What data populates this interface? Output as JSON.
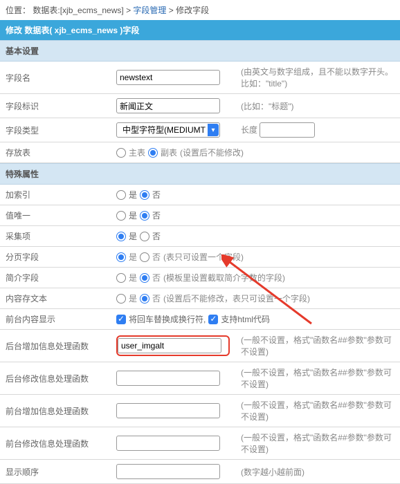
{
  "breadcrumb": {
    "loc": "位置：",
    "table": "数据表:[xjb_ecms_news]",
    "sep": " > ",
    "link1": "字段管理",
    "current": "修改字段"
  },
  "title": "修改 数据表( xjb_ecms_news )字段",
  "sections": {
    "basic": "基本设置",
    "special": "特殊属性"
  },
  "rows": {
    "fname": {
      "label": "字段名",
      "value": "newstext",
      "hint": "(由英文与数字组成，且不能以数字开头。比如：\"title\")"
    },
    "fflag": {
      "label": "字段标识",
      "value": "新闻正文",
      "hint": "(比如：\"标题\")"
    },
    "ftype": {
      "label": "字段类型",
      "value": "中型字符型(MEDIUMTEXT)",
      "len_label": "长度",
      "len_value": ""
    },
    "store": {
      "label": "存放表",
      "main": "主表",
      "sub": "副表",
      "hint": "(设置后不能修改)"
    },
    "index": {
      "label": "加索引",
      "yes": "是",
      "no": "否"
    },
    "unique": {
      "label": "值唯一",
      "yes": "是",
      "no": "否"
    },
    "collect": {
      "label": "采集项",
      "yes": "是",
      "no": "否"
    },
    "page": {
      "label": "分页字段",
      "yes": "是",
      "no": "否",
      "hint": "(表只可设置一个字段)"
    },
    "brief": {
      "label": "简介字段",
      "yes": "是",
      "no": "否",
      "hint": "(模板里设置截取简介字数的字段)"
    },
    "textfile": {
      "label": "内容存文本",
      "yes": "是",
      "no": "否",
      "hint": "(设置后不能修改，表只可设置一个字段)"
    },
    "front": {
      "label": "前台内容显示",
      "br": "将回车替换成换行符,",
      "html": "支持html代码"
    },
    "addb": {
      "label": "后台增加信息处理函数",
      "value": "user_imgalt",
      "hint": "(一般不设置，格式\"函数名##参数\"参数可不设置)"
    },
    "editb": {
      "label": "后台修改信息处理函数",
      "value": "",
      "hint": "(一般不设置，格式\"函数名##参数\"参数可不设置)"
    },
    "addf": {
      "label": "前台增加信息处理函数",
      "value": "",
      "hint": "(一般不设置，格式\"函数名##参数\"参数可不设置)"
    },
    "editf": {
      "label": "前台修改信息处理函数",
      "value": "",
      "hint": "(一般不设置，格式\"函数名##参数\"参数可不设置)"
    },
    "order": {
      "label": "显示顺序",
      "value": "",
      "hint": "(数字越小越前面)"
    }
  }
}
